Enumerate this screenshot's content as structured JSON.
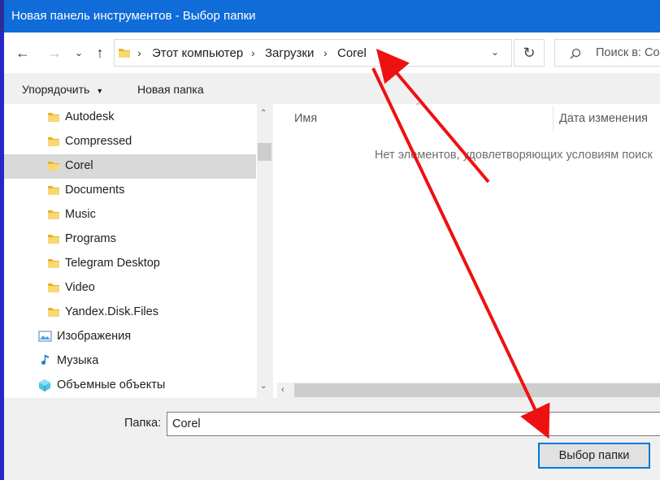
{
  "window": {
    "title": "Новая панель инструментов - Выбор папки"
  },
  "nav": {
    "back_icon": "arrow-left-icon",
    "forward_icon": "arrow-right-icon",
    "recent_icon": "chevron-down-icon",
    "up_icon": "arrow-up-icon",
    "breadcrumb": [
      "Этот компьютер",
      "Загрузки",
      "Corel"
    ],
    "search_placeholder": "Поиск в: Co"
  },
  "toolbar": {
    "organize_label": "Упорядочить",
    "new_folder_label": "Новая папка"
  },
  "tree": {
    "items": [
      {
        "label": "Autodesk",
        "icon": "folder-icon",
        "selected": false
      },
      {
        "label": "Compressed",
        "icon": "folder-icon",
        "selected": false
      },
      {
        "label": "Corel",
        "icon": "folder-icon",
        "selected": true
      },
      {
        "label": "Documents",
        "icon": "folder-icon",
        "selected": false
      },
      {
        "label": "Music",
        "icon": "folder-icon",
        "selected": false
      },
      {
        "label": "Programs",
        "icon": "folder-icon",
        "selected": false
      },
      {
        "label": "Telegram Desktop",
        "icon": "folder-icon",
        "selected": false
      },
      {
        "label": "Video",
        "icon": "folder-icon",
        "selected": false
      },
      {
        "label": "Yandex.Disk.Files",
        "icon": "folder-icon",
        "selected": false
      },
      {
        "label": "Изображения",
        "icon": "pictures-icon",
        "selected": false
      },
      {
        "label": "Музыка",
        "icon": "music-icon",
        "selected": false
      },
      {
        "label": "Объемные объекты",
        "icon": "3d-objects-icon",
        "selected": false
      }
    ]
  },
  "list": {
    "columns": [
      "Имя",
      "Дата изменения"
    ],
    "empty_message": "Нет элементов, удовлетворяющих условиям поиск"
  },
  "footer": {
    "folder_label": "Папка:",
    "folder_value": "Corel",
    "select_button": "Выбор папки"
  },
  "colors": {
    "titlebar": "#0f6cd9",
    "annotation_arrow": "#ee1111",
    "selection": "#d9d9d9"
  }
}
